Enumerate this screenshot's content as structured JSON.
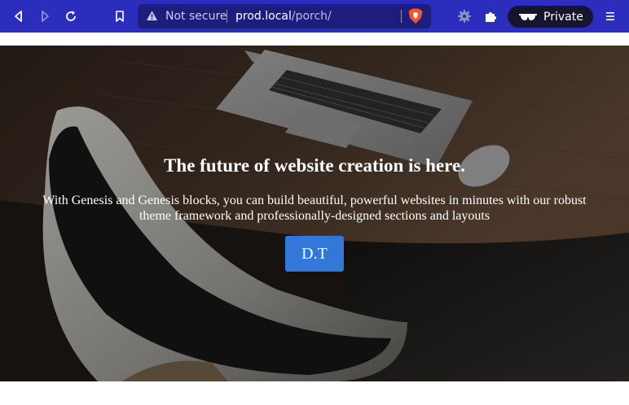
{
  "browser": {
    "security_label": "Not secure",
    "url_host": "prod.local",
    "url_path": "/porch/",
    "private_label": "Private",
    "icons": {
      "back": "back-arrow-icon",
      "forward": "forward-arrow-icon",
      "reload": "reload-icon",
      "bookmark": "bookmark-icon",
      "warning": "warning-triangle-icon",
      "shield": "brave-shields-icon",
      "rewards": "brave-rewards-icon",
      "extensions": "puzzle-piece-icon",
      "private": "private-glasses-icon",
      "menu": "hamburger-menu-icon"
    },
    "colors": {
      "toolbar": "#2b2dbd",
      "urlbar": "#1c1d7d",
      "private_pill": "#15162e"
    }
  },
  "hero": {
    "title": "The future of website creation is here.",
    "description": "With Genesis and Genesis blocks, you can build beautiful, powerful websites in minutes with our robust theme framework and professionally-designed sections and layouts",
    "button_label": "D.T",
    "colors": {
      "button": "#3377d9"
    }
  }
}
